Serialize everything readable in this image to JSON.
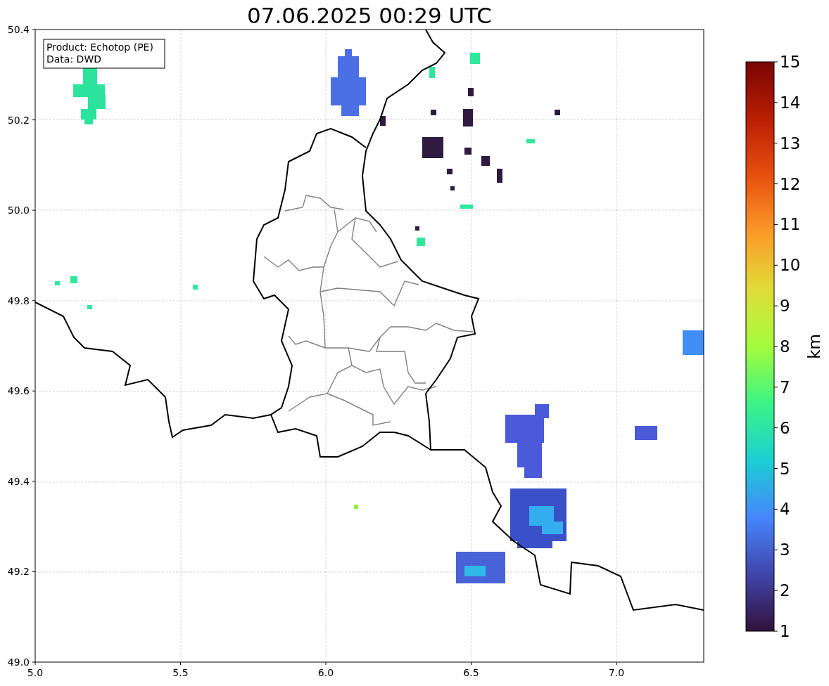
{
  "title": "07.06.2025 00:29 UTC",
  "info_box": {
    "lines": [
      "Product: Echotop (PE)",
      "Data: DWD"
    ]
  },
  "x_ticks": [
    "5.0",
    "5.5",
    "6.0",
    "6.5",
    "7.0"
  ],
  "y_ticks": [
    "50.4",
    "50.2",
    "50.0",
    "49.8",
    "49.6",
    "49.4",
    "49.2",
    "49.0"
  ],
  "colorbar": {
    "label": "km",
    "ticks": [
      "15",
      "14",
      "13",
      "12",
      "11",
      "10",
      "9",
      "8",
      "7",
      "6",
      "5",
      "4",
      "3",
      "2",
      "1"
    ]
  }
}
